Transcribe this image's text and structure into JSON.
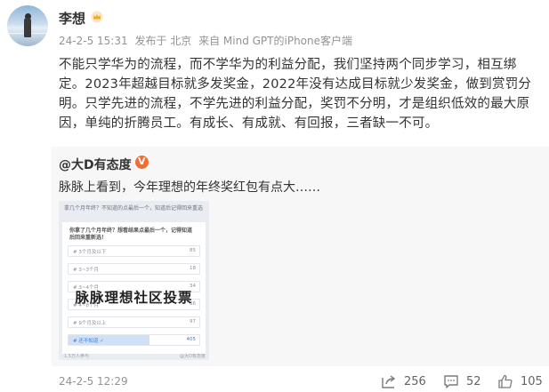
{
  "user": {
    "name": "李想"
  },
  "meta": {
    "time": "24-2-5 15:31",
    "posted_at": "发布于 北京",
    "source": "来自 Mind GPT的iPhone客户端"
  },
  "post": {
    "text": "不能只学华为的流程，而不学华为的利益分配，我们坚持两个同步学习，相互绑定。2023年超越目标就多发奖金，2022年没有达成目标就少发奖金，做到赏罚分明。只学先进的流程，不学先进的利益分配，奖罚不分明，才是组织低效的最大原因，单纯的折腾员工。有成长、有成就、有回报，三者缺一不可。"
  },
  "repost": {
    "author": "@大D有态度",
    "text": "脉脉上看到，今年理想的年终奖红包有点大……",
    "image": {
      "header_question": "拿几个月年终？不知道的点最后一个，知道后记得回来重选",
      "question": "你拿了几个月年终？想看结果点最后一个，记得知道后回来重新选！",
      "options": [
        {
          "label": "# 3个月及以下",
          "count": "85"
        },
        {
          "label": "# 3~3个月",
          "count": "18"
        },
        {
          "label": "# 3~4个月",
          "count": "34"
        },
        {
          "label": "# 4~8个月",
          "count": "36"
        },
        {
          "label": "# 9个月及以上",
          "count": "97"
        },
        {
          "label": "# 还不知道 ✓",
          "count": "405"
        }
      ],
      "watermark": "脉脉理想社区投票",
      "foot_left": "1.5万人参与",
      "foot_right": "@大D有态度"
    }
  },
  "footer": {
    "time": "24-2-5 12:29",
    "shares": "256",
    "comments": "52",
    "likes": "105"
  },
  "colors": {
    "meta_text": "#939393",
    "verified": "#f26d2f",
    "crown": "#f5a623",
    "vote_selected": "#cfe0f7"
  },
  "icons": [
    "crown-icon",
    "verified-icon",
    "share-icon",
    "comment-icon",
    "like-icon"
  ]
}
